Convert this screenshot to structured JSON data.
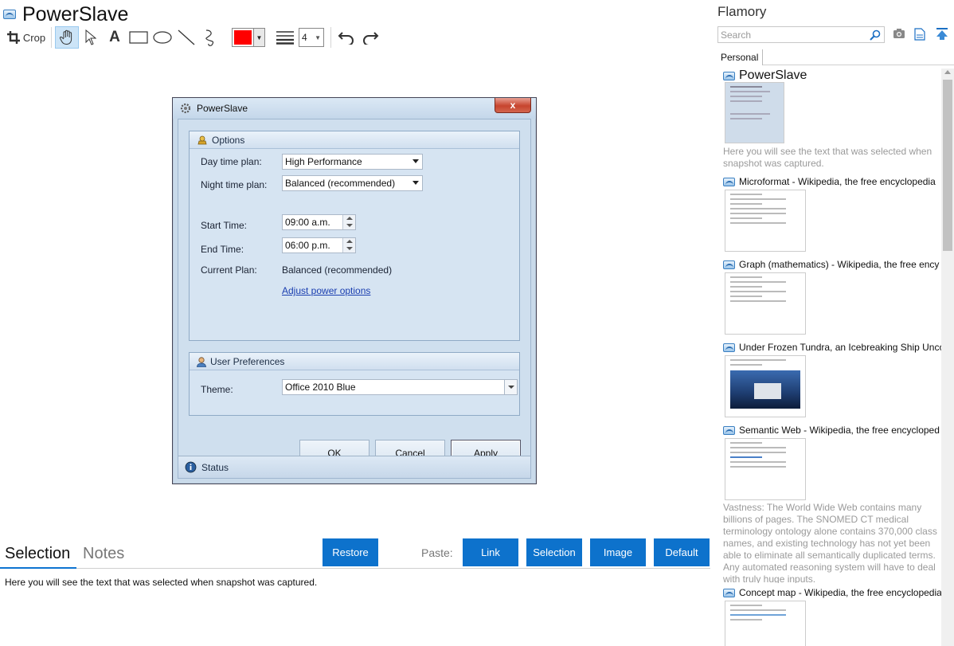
{
  "app": {
    "title": "PowerSlave"
  },
  "toolbar": {
    "crop_label": "Crop",
    "line_width": "4",
    "color": "#ff0000"
  },
  "dialog": {
    "title": "PowerSlave",
    "close_glyph": "x",
    "options_header": "Options",
    "day_plan_label": "Day time plan:",
    "day_plan_value": "High Performance",
    "night_plan_label": "Night time plan:",
    "night_plan_value": "Balanced (recommended)",
    "start_label": "Start Time:",
    "start_value": "09:00 a.m.",
    "end_label": "End Time:",
    "end_value": "06:00 p.m.",
    "current_label": "Current Plan:",
    "current_value": "Balanced (recommended)",
    "adjust_link": "Adjust power options",
    "prefs_header": "User Preferences",
    "theme_label": "Theme:",
    "theme_value": "Office 2010 Blue",
    "ok": "OK",
    "cancel": "Cancel",
    "apply": "Apply",
    "status": "Status"
  },
  "bottom": {
    "tab_selection": "Selection",
    "tab_notes": "Notes",
    "restore": "Restore",
    "paste_label": "Paste:",
    "paste_link": "Link",
    "paste_selection": "Selection",
    "paste_image": "Image",
    "paste_default": "Default",
    "selection_text": "Here you will see the text that was selected when snapshot was captured."
  },
  "flamory": {
    "title": "Flamory",
    "search_placeholder": "Search",
    "tab_personal": "Personal",
    "entries": [
      {
        "title": "PowerSlave",
        "desc": "Here you will see the text that was selected when snapshot was captured."
      },
      {
        "title": "Microformat - Wikipedia, the free encyclopedia"
      },
      {
        "title": "Graph (mathematics) - Wikipedia, the free ency"
      },
      {
        "title": "Under Frozen Tundra, an Icebreaking Ship Unco"
      },
      {
        "title": "Semantic Web - Wikipedia, the free encycloped",
        "desc": "Vastness: The World Wide Web contains many billions of pages. The SNOMED CT medical terminology ontology alone contains 370,000 class names, and existing technology has not yet been able to eliminate all semantically duplicated terms. Any automated reasoning system will have to deal with truly huge inputs."
      },
      {
        "title": "Concept map - Wikipedia, the free encyclopedia"
      }
    ]
  },
  "colors": {
    "accent_blue": "#0d72cc",
    "close_red": "#c7442e"
  }
}
